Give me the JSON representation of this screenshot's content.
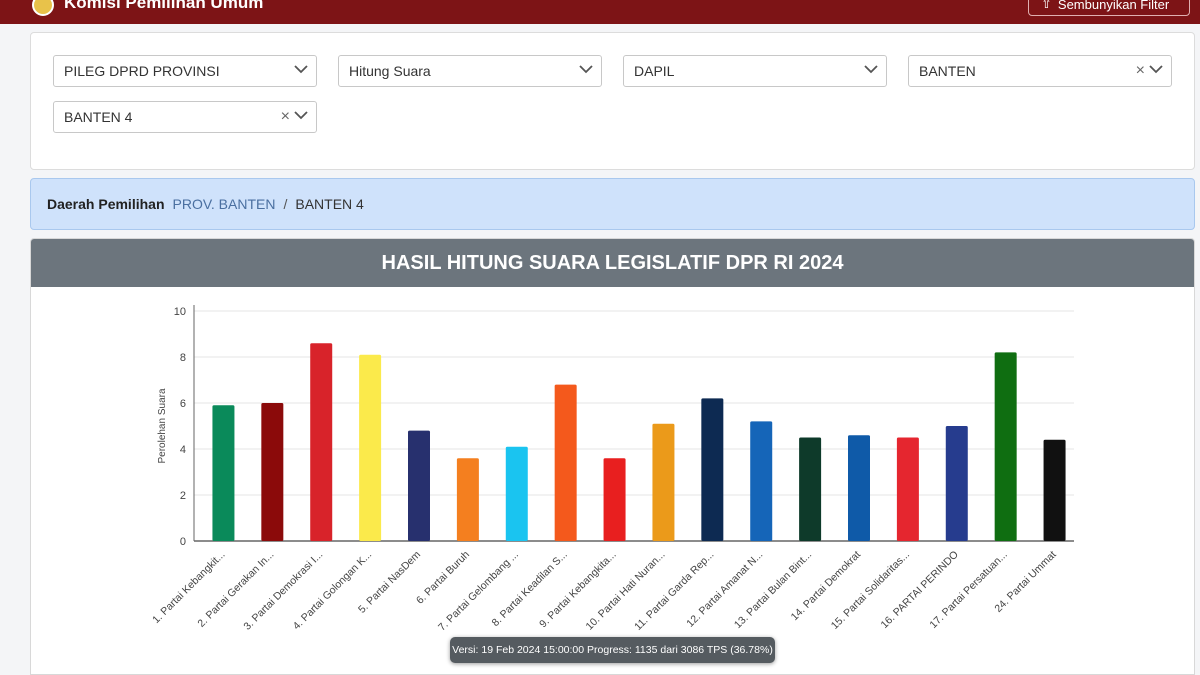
{
  "header": {
    "brand": "Komisi Pemilihan Umum",
    "hide_filter_label": "Sembunyikan Filter"
  },
  "filters": {
    "election_type": "PILEG DPRD PROVINSI",
    "mode": "Hitung Suara",
    "region_level": "DAPIL",
    "province": "BANTEN",
    "dapil": "BANTEN 4",
    "clear_icon": "×"
  },
  "breadcrumb": {
    "label": "Daerah Pemilihan",
    "province": "PROV. BANTEN",
    "separator": "/",
    "current": "BANTEN 4"
  },
  "chart_data": {
    "type": "bar",
    "title": "HASIL HITUNG SUARA LEGISLATIF DPR RI 2024",
    "ylabel": "Perolehan Suara",
    "xlabel": "",
    "ylim": [
      0,
      10
    ],
    "yticks": [
      0,
      2,
      4,
      6,
      8,
      10
    ],
    "grid": true,
    "categories": [
      "1. Partai Kebangkit...",
      "2. Partai Gerakan In...",
      "3. Partai Demokrasi I...",
      "4. Partai Golongan K...",
      "5. Partai NasDem",
      "6. Partai Buruh",
      "7. Partai Gelombang ...",
      "8. Partai Keadilan S...",
      "9. Partai Kebangkita...",
      "10. Partai Hati Nuran...",
      "11. Partai Garda Rep...",
      "12. Partai Amanat N...",
      "13. Partai Bulan Bint...",
      "14. Partai Demokrat",
      "15. Partai Solidaritas...",
      "16. PARTAI PERINDO",
      "17. Partai Persatuan...",
      "24. Partai Ummat"
    ],
    "values": [
      5.9,
      6.0,
      8.6,
      8.1,
      4.8,
      3.6,
      4.1,
      6.8,
      3.6,
      5.1,
      6.2,
      5.2,
      4.5,
      4.6,
      4.5,
      5.0,
      8.2,
      4.4
    ],
    "colors": [
      "#0a8a5a",
      "#8b0a0a",
      "#d8232a",
      "#fbea4b",
      "#27306e",
      "#f47f1f",
      "#1ac4f0",
      "#f4591c",
      "#e81f1f",
      "#eb9a1a",
      "#0d2a52",
      "#1565b8",
      "#0e3a2a",
      "#0f5aa8",
      "#e5262f",
      "#263c8e",
      "#0f6e11",
      "#111111"
    ]
  },
  "tooltip": {
    "text": "Versi: 19 Feb 2024 15:00:00 Progress: 1135 dari 3086 TPS (36.78%)"
  }
}
